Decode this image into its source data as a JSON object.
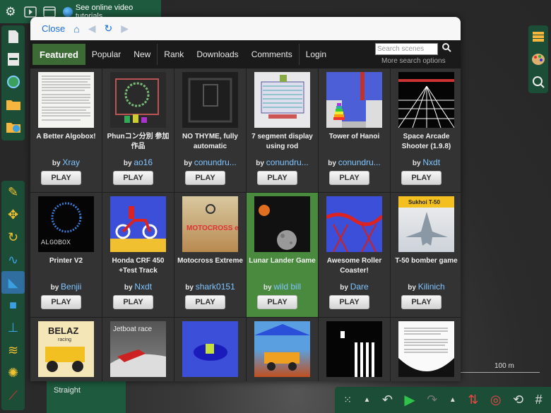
{
  "app": {
    "tutorial_link": "See online video tutorials",
    "straight_label": "Straight",
    "scale_label": "100 m"
  },
  "dialog": {
    "close_label": "Close",
    "menu": [
      "Featured",
      "Popular",
      "New",
      "Rank",
      "Downloads",
      "Comments",
      "Login"
    ],
    "search_placeholder": "Search scenes",
    "more_search": "More search options",
    "play_label": "PLAY",
    "by_label": "by",
    "scenes": [
      {
        "title": "A Better Algobox!",
        "author": "Xray"
      },
      {
        "title": "Phunコン分別 参加作品",
        "author": "ao16"
      },
      {
        "title": "NO THYME, fully automatic",
        "author": "conundru..."
      },
      {
        "title": "7 segment display using rod",
        "author": "conundru..."
      },
      {
        "title": "Tower of Hanoi",
        "author": "conundru..."
      },
      {
        "title": "Space Arcade Shooter (1.9.8)",
        "author": "Nxdt"
      },
      {
        "title": "Printer V2",
        "author": "Benjii"
      },
      {
        "title": "Honda CRF 450 +Test Track",
        "author": "Nxdt"
      },
      {
        "title": "Motocross Extreme",
        "author": "shark0151"
      },
      {
        "title": "Lunar Lander Game",
        "author": "wild bill"
      },
      {
        "title": "Awesome Roller Coaster!",
        "author": "Dare"
      },
      {
        "title": "T-50 bomber game",
        "author": "Kilinich"
      }
    ],
    "thumb_texts": {
      "belaz": "BELAZ",
      "belaz_sub": "racing",
      "jetboat": "Jetboat race",
      "sukhoi": "Sukhoi T-50",
      "motocross": "MOTOCROSS eXtreme",
      "printer": "ALGOBOX"
    }
  }
}
